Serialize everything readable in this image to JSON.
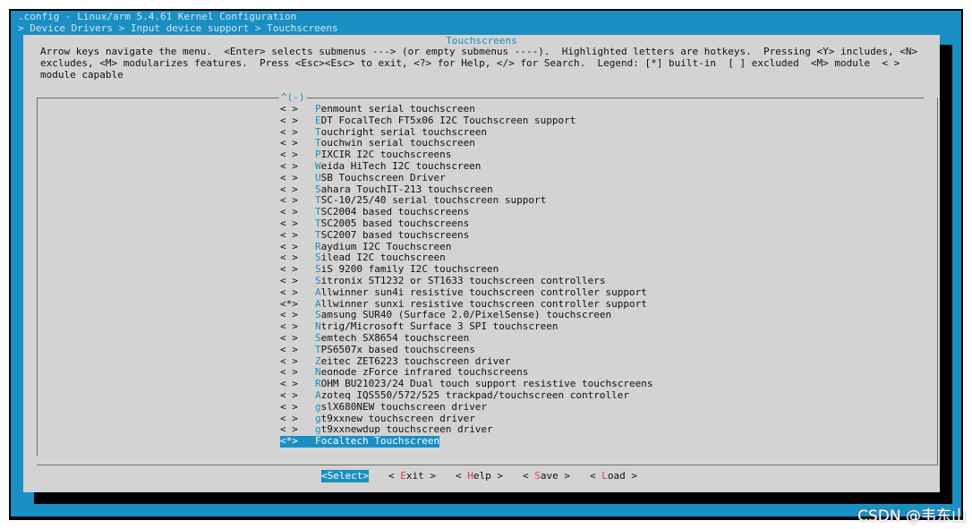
{
  "window": {
    "title": ".config - Linux/arm 5.4.61 Kernel Configuration",
    "breadcrumb": "> Device Drivers > Input device support > Touchscreens"
  },
  "dialog": {
    "title": "Touchscreens",
    "help_text": "Arrow keys navigate the menu.  <Enter> selects submenus ---> (or empty submenus ----).  Highlighted letters are hotkeys.  Pressing <Y> includes, <N> excludes, <M> modularizes features.  Press <Esc><Esc> to exit, <?> for Help, </> for Search.  Legend: [*] built-in  [ ] excluded  <M> module  < > module capable",
    "scroll_indicator": "^(-)"
  },
  "menu": {
    "items": [
      {
        "state": "< >",
        "hot": "P",
        "rest": "enmount serial touchscreen"
      },
      {
        "state": "< >",
        "hot": "E",
        "rest": "DT FocalTech FT5x06 I2C Touchscreen support"
      },
      {
        "state": "< >",
        "hot": "T",
        "rest": "ouchright serial touchscreen"
      },
      {
        "state": "< >",
        "hot": "T",
        "rest": "ouchwin serial touchscreen"
      },
      {
        "state": "< >",
        "hot": "P",
        "rest": "IXCIR I2C touchscreens"
      },
      {
        "state": "< >",
        "hot": "W",
        "rest": "eida HiTech I2C touchscreen"
      },
      {
        "state": "< >",
        "hot": "U",
        "rest": "SB Touchscreen Driver"
      },
      {
        "state": "< >",
        "hot": "S",
        "rest": "ahara TouchIT-213 touchscreen"
      },
      {
        "state": "< >",
        "hot": "T",
        "rest": "SC-10/25/40 serial touchscreen support"
      },
      {
        "state": "< >",
        "hot": "T",
        "rest": "SC2004 based touchscreens"
      },
      {
        "state": "< >",
        "hot": "T",
        "rest": "SC2005 based touchscreens"
      },
      {
        "state": "< >",
        "hot": "T",
        "rest": "SC2007 based touchscreens"
      },
      {
        "state": "< >",
        "hot": "R",
        "rest": "aydium I2C Touchscreen"
      },
      {
        "state": "< >",
        "hot": "S",
        "rest": "ilead I2C touchscreen"
      },
      {
        "state": "< >",
        "hot": "S",
        "rest": "iS 9200 family I2C touchscreen"
      },
      {
        "state": "< >",
        "hot": "S",
        "rest": "itronix ST1232 or ST1633 touchscreen controllers"
      },
      {
        "state": "< >",
        "hot": "A",
        "rest": "llwinner sun4i resistive touchscreen controller support"
      },
      {
        "state": "<*>",
        "hot": "A",
        "rest": "llwinner sunxi resistive touchscreen controller support"
      },
      {
        "state": "< >",
        "hot": "S",
        "rest": "amsung SUR40 (Surface 2.0/PixelSense) touchscreen"
      },
      {
        "state": "< >",
        "hot": "N",
        "rest": "trig/Microsoft Surface 3 SPI touchscreen"
      },
      {
        "state": "< >",
        "hot": "S",
        "rest": "emtech SX8654 touchscreen"
      },
      {
        "state": "< >",
        "hot": "T",
        "rest": "PS6507x based touchscreens"
      },
      {
        "state": "< >",
        "hot": "Z",
        "rest": "eitec ZET6223 touchscreen driver"
      },
      {
        "state": "< >",
        "hot": "N",
        "rest": "eonode zForce infrared touchscreens"
      },
      {
        "state": "< >",
        "hot": "R",
        "rest": "OHM BU21023/24 Dual touch support resistive touchscreens"
      },
      {
        "state": "< >",
        "hot": "A",
        "rest": "zoteq IQS550/572/525 trackpad/touchscreen controller"
      },
      {
        "state": "< >",
        "hot": "g",
        "rest": "slX680NEW touchscreen driver"
      },
      {
        "state": "< >",
        "hot": "g",
        "rest": "t9xxnew touchscreen driver"
      },
      {
        "state": "< >",
        "hot": "g",
        "rest": "t9xxnewdup touchscreen driver"
      },
      {
        "state": "<*>",
        "hot": "F",
        "rest": "ocaltech Touchscreen",
        "selected": true
      }
    ]
  },
  "buttons": [
    {
      "name": "select",
      "pre": "<",
      "hot": "S",
      "post": "elect>",
      "active": true
    },
    {
      "name": "exit",
      "pre": "< ",
      "hot": "E",
      "post": "xit >"
    },
    {
      "name": "help",
      "pre": "< ",
      "hot": "H",
      "post": "elp >"
    },
    {
      "name": "save",
      "pre": "< ",
      "hot": "S",
      "post": "ave >"
    },
    {
      "name": "load",
      "pre": "< ",
      "hot": "L",
      "post": "oad >"
    }
  ],
  "watermark": "CSDN @韦东山"
}
